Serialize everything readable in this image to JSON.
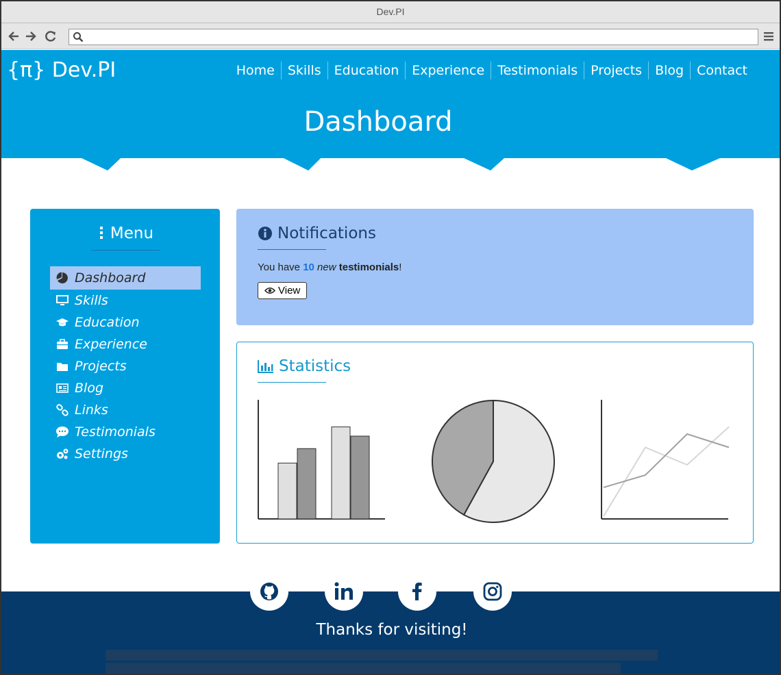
{
  "window": {
    "title": "Dev.PI"
  },
  "browser": {
    "url_value": "",
    "url_placeholder": ""
  },
  "header": {
    "brand": "{π} Dev.PI",
    "nav": [
      "Home",
      "Skills",
      "Education",
      "Experience",
      "Testimonials",
      "Projects",
      "Blog",
      "Contact"
    ],
    "page_title": "Dashboard",
    "color": "#00a0df"
  },
  "sidebar": {
    "title": "Menu",
    "items": [
      {
        "label": "Dashboard",
        "icon": "pie-chart-icon",
        "active": true
      },
      {
        "label": "Skills",
        "icon": "monitor-icon",
        "active": false
      },
      {
        "label": "Education",
        "icon": "graduation-cap-icon",
        "active": false
      },
      {
        "label": "Experience",
        "icon": "briefcase-icon",
        "active": false
      },
      {
        "label": "Projects",
        "icon": "folder-icon",
        "active": false
      },
      {
        "label": "Blog",
        "icon": "newspaper-icon",
        "active": false
      },
      {
        "label": "Links",
        "icon": "link-icon",
        "active": false
      },
      {
        "label": "Testimonials",
        "icon": "speech-bubble-icon",
        "active": false
      },
      {
        "label": "Settings",
        "icon": "gears-icon",
        "active": false
      }
    ]
  },
  "notifications": {
    "title": "Notifications",
    "text_prefix": "You have",
    "count": "10",
    "new_word": "new",
    "item_word": "testimonials",
    "suffix": "!",
    "view_label": "View",
    "bg_color": "#a0c4f7"
  },
  "statistics": {
    "title": "Statistics",
    "accent_color": "#1798cc"
  },
  "chart_data": [
    {
      "type": "bar",
      "categories": [
        "",
        ""
      ],
      "series": [
        {
          "values": [
            85,
            140
          ]
        },
        {
          "values": [
            107,
            126
          ]
        }
      ],
      "ylim": [
        0,
        175
      ],
      "colors": [
        "#e0e0e0",
        "#969696"
      ]
    },
    {
      "type": "pie",
      "values": [
        58,
        42
      ],
      "colors": [
        "#e8e8e8",
        "#a8a8a8"
      ]
    },
    {
      "type": "line",
      "x": [
        0,
        1,
        2,
        3
      ],
      "series": [
        {
          "values": [
            0,
            0.67,
            0.5,
            0.87
          ],
          "color": "#d6d6d6"
        },
        {
          "values": [
            0.28,
            0.4,
            0.8,
            0.67
          ],
          "color": "#a0a0a0"
        }
      ],
      "ylim": [
        0,
        1
      ]
    }
  ],
  "footer": {
    "social": [
      "github-icon",
      "linkedin-icon",
      "facebook-icon",
      "instagram-icon"
    ],
    "thanks": "Thanks for visiting!",
    "bg_color": "#053a6a"
  }
}
